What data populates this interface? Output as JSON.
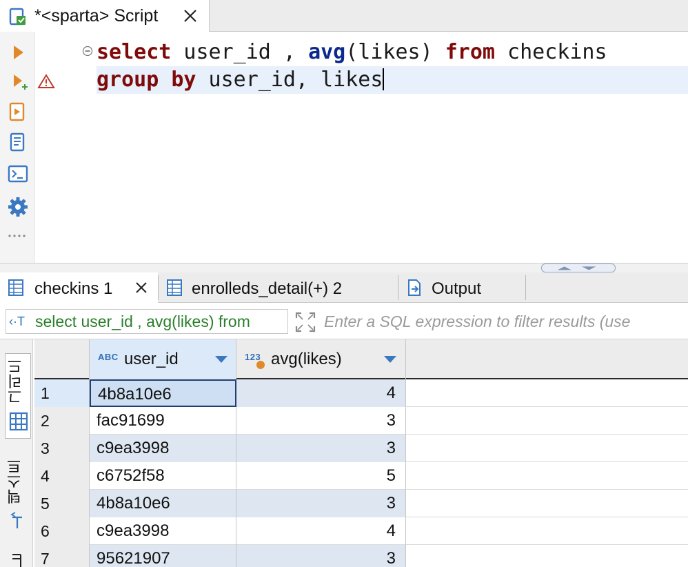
{
  "editor": {
    "tab_title": "*<sparta> Script",
    "code": {
      "line1": {
        "kw1": "select",
        "t1": " user_id , ",
        "fn1": "avg",
        "t2": "(likes) ",
        "kw2": "from",
        "t3": " checkins"
      },
      "line2": {
        "kw1": "group by",
        "t1": " user_id, likes"
      }
    }
  },
  "results": {
    "tabs": [
      {
        "label": "checkins 1"
      },
      {
        "label": "enrolleds_detail(+) 2"
      },
      {
        "label": "Output"
      }
    ],
    "filter": {
      "query_label": "select user_id , avg(likes) from",
      "placeholder": "Enter a SQL expression to filter results (use"
    },
    "view_tabs": {
      "grid": "그리드",
      "text": "텍스트"
    },
    "columns": [
      {
        "type_badge": "ABC",
        "name": "user_id"
      },
      {
        "type_badge": "123",
        "name": "avg(likes)"
      }
    ],
    "rows": [
      {
        "num": "1",
        "user_id": "4b8a10e6",
        "avg": "4"
      },
      {
        "num": "2",
        "user_id": "fac91699",
        "avg": "3"
      },
      {
        "num": "3",
        "user_id": "c9ea3998",
        "avg": "3"
      },
      {
        "num": "4",
        "user_id": "c6752f58",
        "avg": "5"
      },
      {
        "num": "5",
        "user_id": "4b8a10e6",
        "avg": "3"
      },
      {
        "num": "6",
        "user_id": "c9ea3998",
        "avg": "4"
      },
      {
        "num": "7",
        "user_id": "95621907",
        "avg": "3"
      }
    ]
  },
  "colors": {
    "keyword": "#7f0a0a",
    "function": "#0b2a8c",
    "current_line": "#e8f0fb",
    "selection": "#dce9f8",
    "filter_text": "#2a7f2a"
  },
  "icons": {
    "tab": "sql-script-icon",
    "toolbar": [
      "execute-statement-icon",
      "execute-in-new-tab-icon",
      "execute-script-icon",
      "explain-plan-icon",
      "terminal-icon",
      "settings-gear-icon",
      "more-dots-icon"
    ],
    "gutter": "warning-triangle-icon"
  }
}
